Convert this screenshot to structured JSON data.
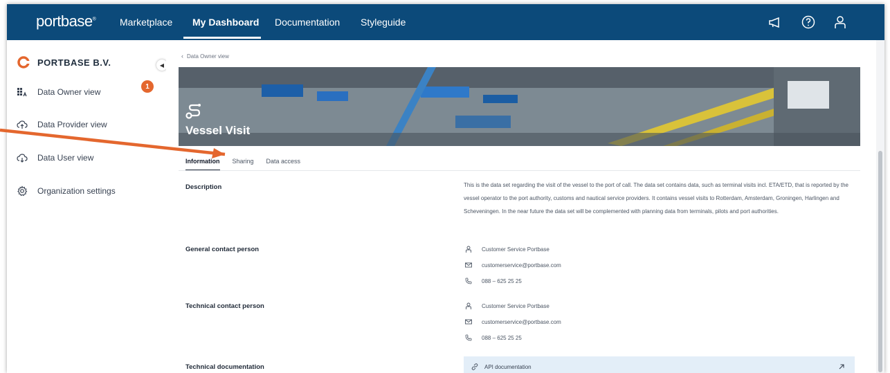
{
  "app": {
    "logo": "portbase",
    "logo_mark": "®"
  },
  "topnav": {
    "items": [
      {
        "label": "Marketplace"
      },
      {
        "label": "My Dashboard",
        "active": true
      },
      {
        "label": "Documentation"
      },
      {
        "label": "Styleguide"
      }
    ],
    "icons": [
      "megaphone-icon",
      "help-icon",
      "user-icon"
    ]
  },
  "sidebar": {
    "organization": "PORTBASE B.V.",
    "items": [
      {
        "label": "Data Owner view",
        "icon": "data-owner-icon",
        "badge": "1"
      },
      {
        "label": "Data Provider view",
        "icon": "cloud-upload-icon"
      },
      {
        "label": "Data User view",
        "icon": "cloud-download-icon"
      },
      {
        "label": "Organization settings",
        "icon": "gear-icon"
      }
    ]
  },
  "breadcrumb": {
    "back_label": "Data Owner view"
  },
  "dataset": {
    "title": "Vessel Visit"
  },
  "tabs": [
    {
      "label": "Information",
      "active": true
    },
    {
      "label": "Sharing"
    },
    {
      "label": "Data access"
    }
  ],
  "info": {
    "description_label": "Description",
    "description": "This is the data set regarding the visit of the vessel to the port of call. The data set contains data, such as terminal visits incl. ETA/ETD, that is reported by the vessel operator to the port authority, customs and nautical service providers. It contains vessel visits to Rotterdam, Amsterdam, Groningen, Harlingen and Scheveningen. In the near future the data set will be complemented with planning data from terminals, pilots and port authorities.",
    "general_contact_label": "General contact person",
    "general_contact": {
      "name": "Customer Service Portbase",
      "email": "customerservice@portbase.com",
      "phone": "088 – 625 25 25"
    },
    "technical_contact_label": "Technical contact person",
    "technical_contact": {
      "name": "Customer Service Portbase",
      "email": "customerservice@portbase.com",
      "phone": "088 – 625 25 25"
    },
    "technical_docs_label": "Technical documentation",
    "api_link_label": "API documentation"
  },
  "colors": {
    "nav": "#0c4a7a",
    "accent": "#e4672e",
    "api_bg": "#e3eef8"
  }
}
